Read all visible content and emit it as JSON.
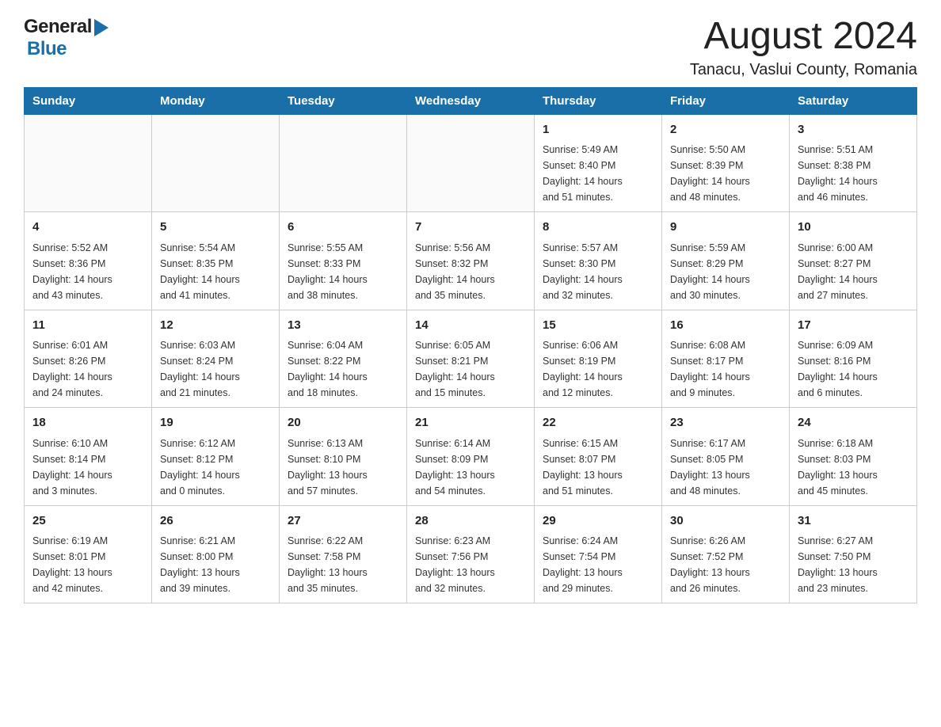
{
  "header": {
    "logo_general": "General",
    "logo_blue": "Blue",
    "month_year": "August 2024",
    "location": "Tanacu, Vaslui County, Romania"
  },
  "weekdays": [
    "Sunday",
    "Monday",
    "Tuesday",
    "Wednesday",
    "Thursday",
    "Friday",
    "Saturday"
  ],
  "weeks": [
    [
      {
        "day": "",
        "info": ""
      },
      {
        "day": "",
        "info": ""
      },
      {
        "day": "",
        "info": ""
      },
      {
        "day": "",
        "info": ""
      },
      {
        "day": "1",
        "info": "Sunrise: 5:49 AM\nSunset: 8:40 PM\nDaylight: 14 hours\nand 51 minutes."
      },
      {
        "day": "2",
        "info": "Sunrise: 5:50 AM\nSunset: 8:39 PM\nDaylight: 14 hours\nand 48 minutes."
      },
      {
        "day": "3",
        "info": "Sunrise: 5:51 AM\nSunset: 8:38 PM\nDaylight: 14 hours\nand 46 minutes."
      }
    ],
    [
      {
        "day": "4",
        "info": "Sunrise: 5:52 AM\nSunset: 8:36 PM\nDaylight: 14 hours\nand 43 minutes."
      },
      {
        "day": "5",
        "info": "Sunrise: 5:54 AM\nSunset: 8:35 PM\nDaylight: 14 hours\nand 41 minutes."
      },
      {
        "day": "6",
        "info": "Sunrise: 5:55 AM\nSunset: 8:33 PM\nDaylight: 14 hours\nand 38 minutes."
      },
      {
        "day": "7",
        "info": "Sunrise: 5:56 AM\nSunset: 8:32 PM\nDaylight: 14 hours\nand 35 minutes."
      },
      {
        "day": "8",
        "info": "Sunrise: 5:57 AM\nSunset: 8:30 PM\nDaylight: 14 hours\nand 32 minutes."
      },
      {
        "day": "9",
        "info": "Sunrise: 5:59 AM\nSunset: 8:29 PM\nDaylight: 14 hours\nand 30 minutes."
      },
      {
        "day": "10",
        "info": "Sunrise: 6:00 AM\nSunset: 8:27 PM\nDaylight: 14 hours\nand 27 minutes."
      }
    ],
    [
      {
        "day": "11",
        "info": "Sunrise: 6:01 AM\nSunset: 8:26 PM\nDaylight: 14 hours\nand 24 minutes."
      },
      {
        "day": "12",
        "info": "Sunrise: 6:03 AM\nSunset: 8:24 PM\nDaylight: 14 hours\nand 21 minutes."
      },
      {
        "day": "13",
        "info": "Sunrise: 6:04 AM\nSunset: 8:22 PM\nDaylight: 14 hours\nand 18 minutes."
      },
      {
        "day": "14",
        "info": "Sunrise: 6:05 AM\nSunset: 8:21 PM\nDaylight: 14 hours\nand 15 minutes."
      },
      {
        "day": "15",
        "info": "Sunrise: 6:06 AM\nSunset: 8:19 PM\nDaylight: 14 hours\nand 12 minutes."
      },
      {
        "day": "16",
        "info": "Sunrise: 6:08 AM\nSunset: 8:17 PM\nDaylight: 14 hours\nand 9 minutes."
      },
      {
        "day": "17",
        "info": "Sunrise: 6:09 AM\nSunset: 8:16 PM\nDaylight: 14 hours\nand 6 minutes."
      }
    ],
    [
      {
        "day": "18",
        "info": "Sunrise: 6:10 AM\nSunset: 8:14 PM\nDaylight: 14 hours\nand 3 minutes."
      },
      {
        "day": "19",
        "info": "Sunrise: 6:12 AM\nSunset: 8:12 PM\nDaylight: 14 hours\nand 0 minutes."
      },
      {
        "day": "20",
        "info": "Sunrise: 6:13 AM\nSunset: 8:10 PM\nDaylight: 13 hours\nand 57 minutes."
      },
      {
        "day": "21",
        "info": "Sunrise: 6:14 AM\nSunset: 8:09 PM\nDaylight: 13 hours\nand 54 minutes."
      },
      {
        "day": "22",
        "info": "Sunrise: 6:15 AM\nSunset: 8:07 PM\nDaylight: 13 hours\nand 51 minutes."
      },
      {
        "day": "23",
        "info": "Sunrise: 6:17 AM\nSunset: 8:05 PM\nDaylight: 13 hours\nand 48 minutes."
      },
      {
        "day": "24",
        "info": "Sunrise: 6:18 AM\nSunset: 8:03 PM\nDaylight: 13 hours\nand 45 minutes."
      }
    ],
    [
      {
        "day": "25",
        "info": "Sunrise: 6:19 AM\nSunset: 8:01 PM\nDaylight: 13 hours\nand 42 minutes."
      },
      {
        "day": "26",
        "info": "Sunrise: 6:21 AM\nSunset: 8:00 PM\nDaylight: 13 hours\nand 39 minutes."
      },
      {
        "day": "27",
        "info": "Sunrise: 6:22 AM\nSunset: 7:58 PM\nDaylight: 13 hours\nand 35 minutes."
      },
      {
        "day": "28",
        "info": "Sunrise: 6:23 AM\nSunset: 7:56 PM\nDaylight: 13 hours\nand 32 minutes."
      },
      {
        "day": "29",
        "info": "Sunrise: 6:24 AM\nSunset: 7:54 PM\nDaylight: 13 hours\nand 29 minutes."
      },
      {
        "day": "30",
        "info": "Sunrise: 6:26 AM\nSunset: 7:52 PM\nDaylight: 13 hours\nand 26 minutes."
      },
      {
        "day": "31",
        "info": "Sunrise: 6:27 AM\nSunset: 7:50 PM\nDaylight: 13 hours\nand 23 minutes."
      }
    ]
  ]
}
